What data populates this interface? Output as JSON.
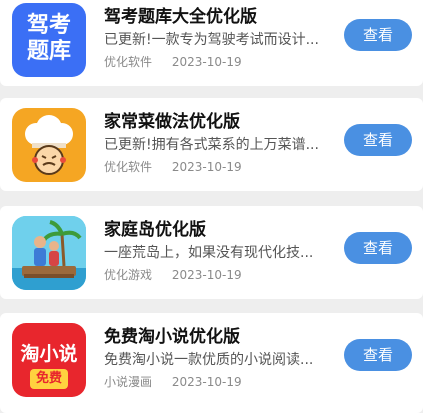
{
  "button_label": "查看",
  "apps": [
    {
      "title": "驾考题库大全优化版",
      "desc": "已更新!一款专为驾驶考试而设计...",
      "category": "优化软件",
      "date": "2023-10-19",
      "icon": {
        "name": "jiakao-tiku-icon",
        "bg": "#3b6ff5",
        "text": [
          "驾考",
          "题库"
        ]
      }
    },
    {
      "title": "家常菜做法优化版",
      "desc": "已更新!拥有各式菜系的上万菜谱...",
      "category": "优化软件",
      "date": "2023-10-19",
      "icon": {
        "name": "chef-hat-icon",
        "bg": "#f5a623"
      }
    },
    {
      "title": "家庭岛优化版",
      "desc": "一座荒岛上，如果没有现代化技...",
      "category": "优化游戏",
      "date": "2023-10-19",
      "icon": {
        "name": "family-island-icon",
        "bg": "#5cc7e6"
      }
    },
    {
      "title": "免费淘小说优化版",
      "desc": "免费淘小说一款优质的小说阅读...",
      "category": "小说漫画",
      "date": "2023-10-19",
      "icon": {
        "name": "taoxiaoshuo-icon",
        "bg": "#e8262d",
        "text": [
          "淘小说",
          "免费"
        ]
      }
    }
  ]
}
